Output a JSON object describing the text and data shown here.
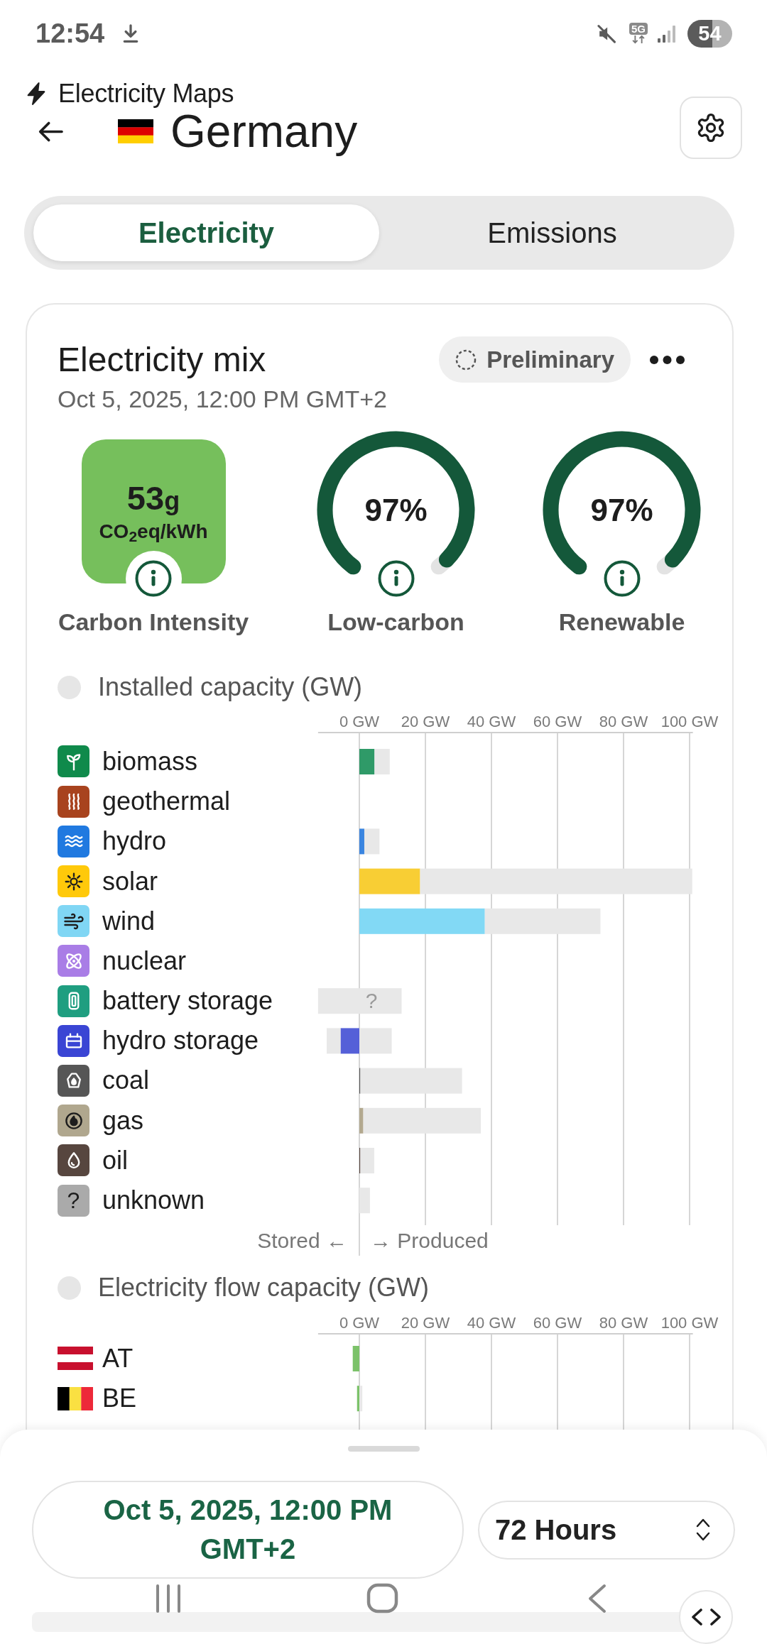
{
  "status_bar": {
    "time": "12:54",
    "network": "5G",
    "battery": "54"
  },
  "header": {
    "app_name": "Electricity Maps",
    "title": "Germany",
    "flag": {
      "kind": "germany"
    }
  },
  "tabs": [
    {
      "label": "Electricity",
      "selected": true
    },
    {
      "label": "Emissions",
      "selected": false
    }
  ],
  "electricity_mix": {
    "title": "Electricity mix",
    "subtitle": "Oct 5, 2025, 12:00 PM GMT+2",
    "badge": "Preliminary",
    "summary": [
      {
        "kind": "intensity",
        "value": "53",
        "unit": "g",
        "subunit": "CO$_{2}$eq/kWh",
        "label": "Carbon Intensity",
        "color": "#76bf5c"
      },
      {
        "kind": "gauge",
        "value": "97%",
        "level": 0.97,
        "label": "Low-carbon",
        "color": "#14583a"
      },
      {
        "kind": "gauge",
        "value": "97%",
        "level": 0.97,
        "label": "Renewable",
        "color": "#14583a"
      }
    ],
    "installed_capacity": {
      "source_icons": [
        {
          "kind": "leaf",
          "color": "#0f8a4b"
        },
        {
          "kind": "heat",
          "color": "#a8431e"
        },
        {
          "kind": "waves",
          "color": "#2079e0"
        },
        {
          "kind": "sun",
          "color": "#ffc90a"
        },
        {
          "kind": "wind",
          "color": "#80d6f4"
        },
        {
          "kind": "atom",
          "color": "#a97de6"
        },
        {
          "kind": "battery",
          "color": "#1f9e80"
        },
        {
          "kind": "dam",
          "color": "#3a45d4"
        },
        {
          "kind": "rock",
          "color": "#565656"
        },
        {
          "kind": "flame",
          "color": "#b0a78e"
        },
        {
          "kind": "drop",
          "color": "#57463f"
        },
        {
          "kind": "question",
          "color": "#aaaaaa",
          "symbol": "?"
        }
      ],
      "chart_data": {
        "type": "bar",
        "orientation": "horizontal",
        "title": "Installed capacity (GW)",
        "categories": [
          "biomass",
          "geothermal",
          "hydro",
          "solar",
          "wind",
          "nuclear",
          "battery storage",
          "hydro storage",
          "coal",
          "gas",
          "oil",
          "unknown"
        ],
        "xlim": [
          -12.5,
          101
        ],
        "xticks": [
          {
            "value": 0,
            "label": "0 GW"
          },
          {
            "value": 20,
            "label": "20 GW"
          },
          {
            "value": 40,
            "label": "40 GW"
          },
          {
            "value": 60,
            "label": "60 GW"
          },
          {
            "value": 80,
            "label": "80 GW"
          },
          {
            "value": 100,
            "label": "100 GW"
          }
        ],
        "grid": true,
        "stacked": true,
        "series": [
          {
            "colors": [
              "#2f9a68",
              null,
              "#3a85e0",
              "#f8ce34",
              "#82d9f5",
              null,
              null,
              "#5560d8",
              "#565656",
              "#b3a98f",
              "#57463f",
              null
            ],
            "values": [
              4.6,
              0,
              1.5,
              18.4,
              38.0,
              0,
              null,
              -5.7,
              0.3,
              1.2,
              0.3,
              0
            ]
          },
          {
            "color": "#e8e8e8",
            "values": [
              4.6,
              0,
              4.6,
              82.4,
              35.0,
              0,
              12.8,
              9.8,
              30.8,
              35.6,
              4.2,
              3.2
            ]
          },
          {
            "color": "#e8e8e8",
            "values": [
              null,
              null,
              null,
              null,
              null,
              null,
              -12.5,
              -4.2,
              null,
              null,
              null,
              null
            ]
          }
        ],
        "annotations": [
          "?"
        ]
      },
      "direction_labels": [
        "Stored ←",
        "→ Produced"
      ]
    },
    "flow_capacity": {
      "rows": [
        {
          "label": "AT",
          "flag": {
            "kind": "austria"
          }
        },
        {
          "label": "BE",
          "flag": {
            "kind": "belgium"
          }
        }
      ],
      "chart_data": {
        "type": "bar",
        "orientation": "horizontal",
        "title": "Electricity flow capacity (GW)",
        "xlim": [
          -12.5,
          101
        ],
        "xticks": [
          {
            "value": 0,
            "label": "0 GW"
          },
          {
            "value": 20,
            "label": "20 GW"
          },
          {
            "value": 40,
            "label": "40 GW"
          },
          {
            "value": 60,
            "label": "60 GW"
          },
          {
            "value": 80,
            "label": "80 GW"
          },
          {
            "value": 100,
            "label": "100 GW"
          }
        ],
        "grid": true,
        "stacked": true,
        "series": [
          {
            "color": "#7cc26a",
            "values": [
              -2.0,
              -0.7
            ]
          },
          {
            "color": "#e8e8e8",
            "values": [
              null,
              0.9
            ]
          }
        ]
      }
    }
  },
  "bottom_sheet": {
    "date": "Oct 5, 2025, 12:00 PM GMT+2",
    "range": "72 Hours"
  }
}
